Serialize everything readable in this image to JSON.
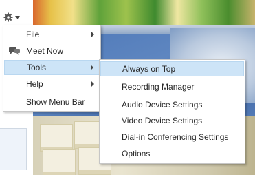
{
  "main_menu": {
    "items": [
      {
        "label": "File",
        "has_submenu": true
      },
      {
        "label": "Meet Now",
        "has_submenu": false,
        "icon": "meet-now-icon"
      },
      {
        "label": "Tools",
        "has_submenu": true,
        "highlighted": true
      },
      {
        "label": "Help",
        "has_submenu": true
      },
      {
        "label": "Show Menu Bar",
        "has_submenu": false
      }
    ]
  },
  "tools_submenu": {
    "items": [
      {
        "label": "Always on Top",
        "highlighted": true
      },
      {
        "label": "Recording Manager"
      },
      {
        "label": "Audio Device Settings"
      },
      {
        "label": "Video Device Settings"
      },
      {
        "label": "Dial-in Conferencing Settings"
      },
      {
        "label": "Options"
      }
    ]
  },
  "colors": {
    "highlight": "#cde4f7",
    "menu_border": "#c6c6c6"
  },
  "icons": {
    "gear": "gear-icon",
    "dropdown": "chevron-down-icon",
    "meet_now": "meet-now-icon"
  }
}
